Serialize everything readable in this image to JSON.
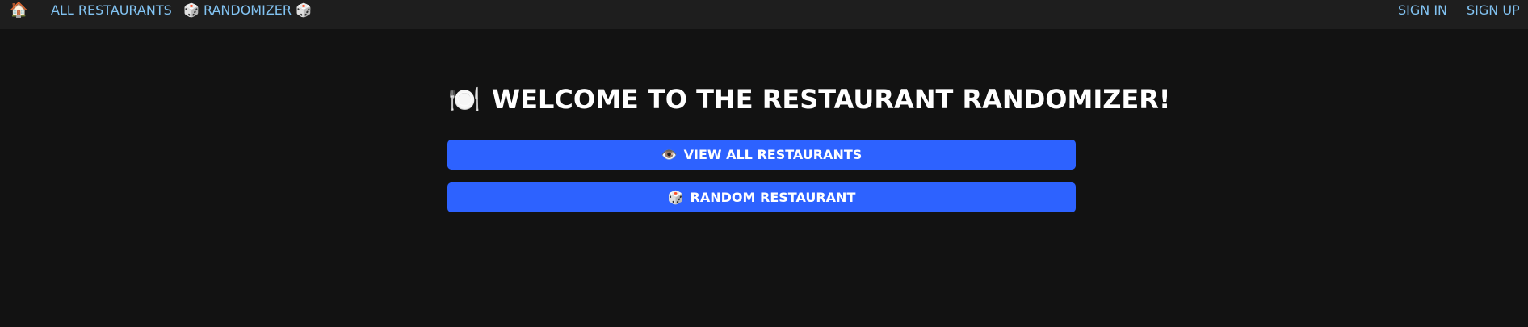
{
  "nav": {
    "home_icon": "🏠",
    "all_restaurants": "ALL RESTAURANTS",
    "randomizer": "🎲 RANDOMIZER 🎲",
    "sign_in": "SIGN IN",
    "sign_up": "SIGN UP"
  },
  "main": {
    "title_icon": "🍽️",
    "title": "WELCOME TO THE RESTAURANT RANDOMIZER!",
    "view_button": {
      "icon": "👁️",
      "label": "VIEW ALL RESTAURANTS"
    },
    "random_button": {
      "icon": "🎲",
      "label": "RANDOM RESTAURANT"
    }
  },
  "colors": {
    "background": "#121212",
    "navbar": "#1e1e1e",
    "nav_link": "#82c3f2",
    "button": "#2d62ff",
    "text": "#ffffff"
  },
  "icons": {
    "home": "home-icon",
    "view": "eye-icon",
    "random": "dice-icon",
    "title": "plate-icon"
  }
}
